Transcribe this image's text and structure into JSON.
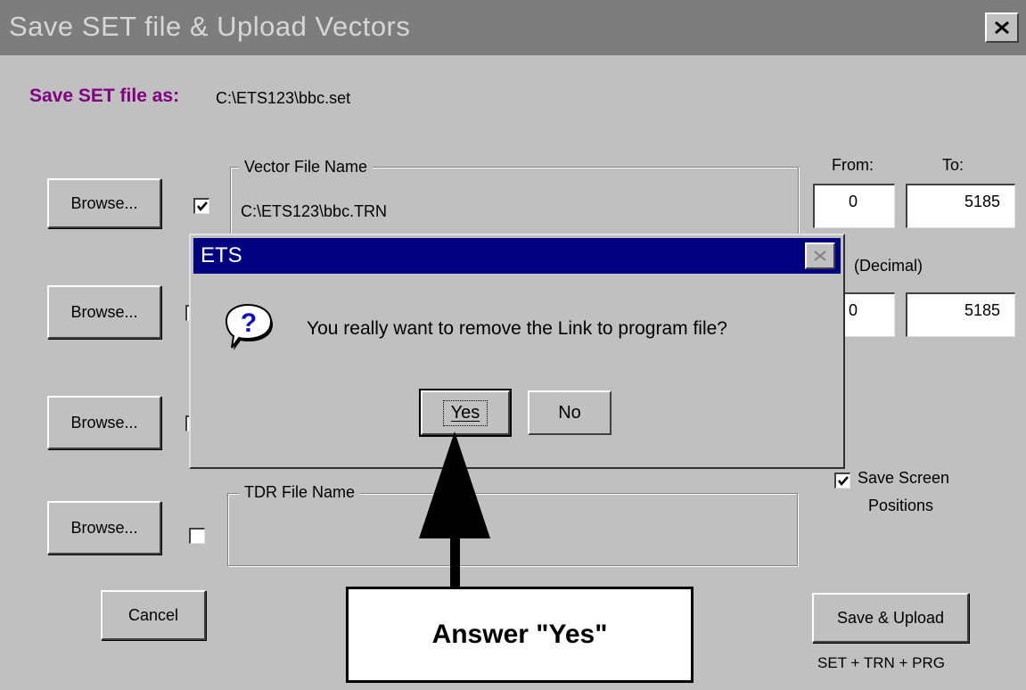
{
  "window": {
    "title": "Save SET file & Upload Vectors"
  },
  "save_set": {
    "label": "Save SET file as:",
    "path": "C:\\ETS123\\bbc.set"
  },
  "vector_group": {
    "title": "Vector File Name",
    "value": "C:\\ETS123\\bbc.TRN",
    "checked": true
  },
  "range": {
    "from_label": "From:",
    "to_label": "To:",
    "from_value": "0",
    "to_value": "5185",
    "decimal_label": "(Decimal)",
    "from_value_2": "0",
    "to_value_2": "5185"
  },
  "browse_buttons": [
    "Browse...",
    "Browse...",
    "Browse...",
    "Browse..."
  ],
  "tdr_group": {
    "title": "TDR File Name",
    "value": "",
    "checked": false
  },
  "save_screen": {
    "label_line1": "Save Screen",
    "label_line2": "Positions",
    "checked": true
  },
  "cancel_label": "Cancel",
  "save_upload": {
    "label": "Save & Upload",
    "caption": "SET + TRN + PRG"
  },
  "dialog": {
    "title": "ETS",
    "message": "You really want to remove the Link to program file?",
    "yes_label": "Yes",
    "no_label": "No",
    "icon": "question-icon"
  },
  "callout": {
    "text": "Answer \"Yes\""
  },
  "colors": {
    "window_bg": "#c0c0c0",
    "inactive_titlebar": "#7d7d7d",
    "active_titlebar": "#000080",
    "label_purple": "#800080"
  }
}
